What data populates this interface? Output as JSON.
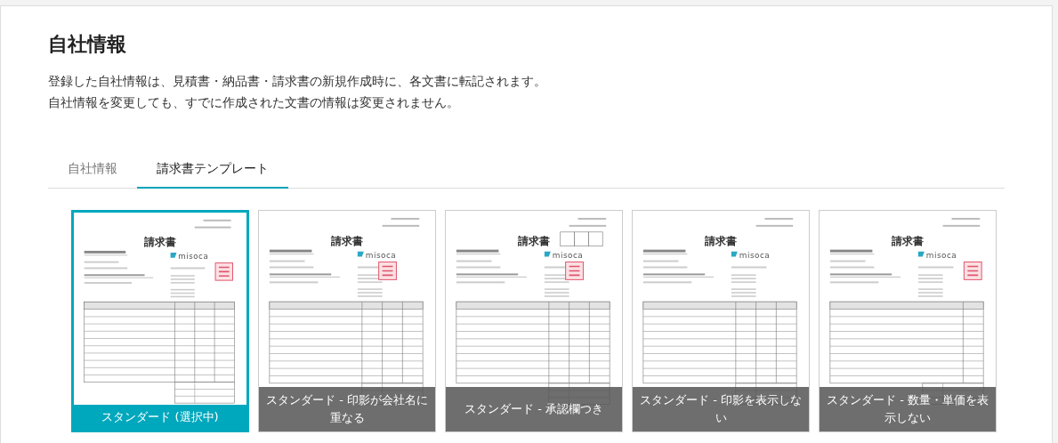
{
  "title": "自社情報",
  "description": [
    "登録した自社情報は、見積書・納品書・請求書の新規作成時に、各文書に転記されます。",
    "自社情報を変更しても、すでに作成された文書の情報は変更されません。"
  ],
  "tabs": [
    {
      "label": "自社情報",
      "selected": false
    },
    {
      "label": "請求書テンプレート",
      "selected": true
    }
  ],
  "templates": [
    {
      "label": "スタンダード (選択中)",
      "selected": true,
      "doc_title": "請求書",
      "logo": "misoca",
      "kind": "standard"
    },
    {
      "label": "スタンダード - 印影が会社名に重なる",
      "selected": false,
      "doc_title": "請求書",
      "logo": "misoca",
      "kind": "overlap"
    },
    {
      "label": "スタンダード - 承認欄つき",
      "selected": false,
      "doc_title": "請求書",
      "logo": "misoca",
      "kind": "approval"
    },
    {
      "label": "スタンダード - 印影を表示しない",
      "selected": false,
      "doc_title": "請求書",
      "logo": "misoca",
      "kind": "nostamp"
    },
    {
      "label": "スタンダード - 数量・単価を表示しない",
      "selected": false,
      "doc_title": "請求書",
      "logo": "misoca",
      "kind": "noqty"
    }
  ]
}
